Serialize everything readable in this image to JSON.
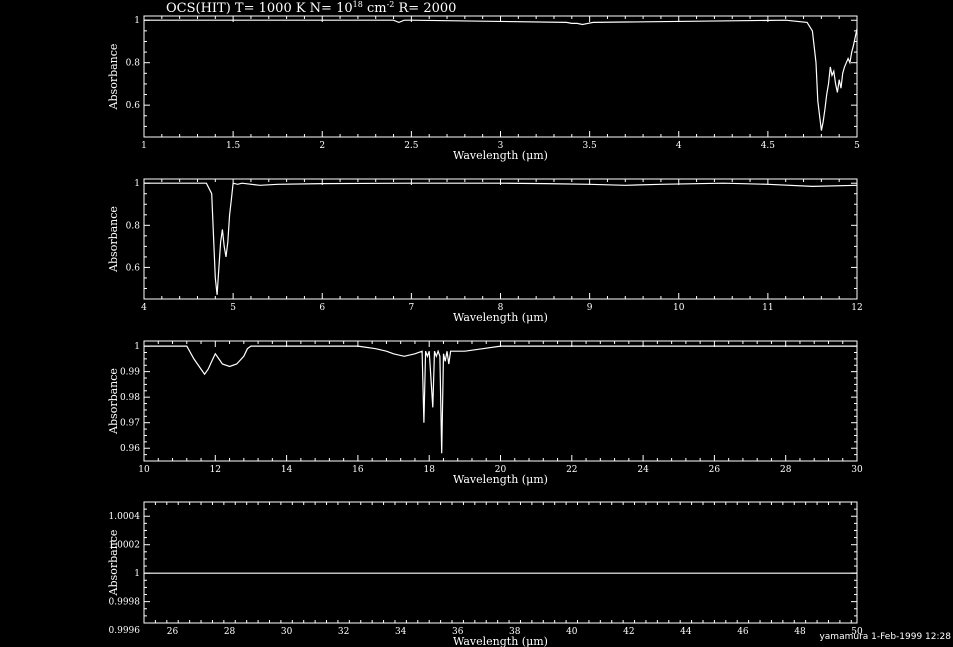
{
  "title": {
    "prefix": "OCS(HIT) T= 1000 K N= 10",
    "n_exp": "18",
    "mid": " cm",
    "cm_exp": "-2",
    "suffix": " R= 2000"
  },
  "footer": "yamamura  1-Feb-1999 12:28",
  "colors": {
    "background": "#000000",
    "foreground": "#ffffff"
  },
  "chart_data": [
    {
      "type": "line",
      "xlabel": "Wavelength (μm)",
      "ylabel": "Absorbance",
      "xlim": [
        1,
        5
      ],
      "ylim": [
        0.45,
        1.02
      ],
      "xticks": [
        1,
        1.5,
        2,
        2.5,
        3,
        3.5,
        4,
        4.5,
        5
      ],
      "xtick_labels": [
        "1",
        "1.5",
        "2",
        "2.5",
        "3",
        "3.5",
        "4",
        "4.5",
        "5"
      ],
      "yticks": [
        0.6,
        0.8,
        1
      ],
      "ytick_labels": [
        "0.6",
        "0.8",
        "1"
      ],
      "series": [
        {
          "x": [
            1,
            2.4,
            2.43,
            2.46,
            2.5,
            3.37,
            3.4,
            3.43,
            3.46,
            3.49,
            3.52,
            4.6,
            4.72,
            4.75,
            4.77,
            4.78,
            4.79,
            4.8,
            4.81,
            4.82,
            4.83,
            4.84,
            4.85,
            4.86,
            4.87,
            4.88,
            4.89,
            4.9,
            4.91,
            4.92,
            4.93,
            4.94,
            4.95,
            4.96,
            4.97,
            4.98,
            4.99,
            5
          ],
          "y": [
            1,
            1,
            0.99,
            1,
            1,
            0.99,
            0.985,
            0.985,
            0.98,
            0.985,
            0.99,
            1,
            0.99,
            0.95,
            0.8,
            0.62,
            0.55,
            0.48,
            0.52,
            0.58,
            0.65,
            0.7,
            0.78,
            0.74,
            0.76,
            0.7,
            0.66,
            0.72,
            0.68,
            0.75,
            0.78,
            0.8,
            0.82,
            0.8,
            0.85,
            0.88,
            0.92,
            0.96
          ]
        }
      ]
    },
    {
      "type": "line",
      "xlabel": "Wavelength (μm)",
      "ylabel": "Absorbance",
      "xlim": [
        4,
        12
      ],
      "ylim": [
        0.45,
        1.02
      ],
      "xticks": [
        4,
        5,
        6,
        7,
        8,
        9,
        10,
        11,
        12
      ],
      "xtick_labels": [
        "4",
        "5",
        "6",
        "7",
        "8",
        "9",
        "10",
        "11",
        "12"
      ],
      "yticks": [
        0.6,
        0.8,
        1
      ],
      "ytick_labels": [
        "0.6",
        "0.8",
        "1"
      ],
      "series": [
        {
          "x": [
            4,
            4.7,
            4.76,
            4.78,
            4.8,
            4.82,
            4.84,
            4.86,
            4.88,
            4.9,
            4.92,
            4.94,
            4.96,
            4.98,
            5,
            5.05,
            5.1,
            5.3,
            5.5,
            6,
            7,
            8,
            8.5,
            9,
            9.4,
            9.8,
            10.5,
            11,
            11.5,
            12
          ],
          "y": [
            1,
            1,
            0.95,
            0.75,
            0.55,
            0.47,
            0.6,
            0.72,
            0.78,
            0.7,
            0.65,
            0.72,
            0.85,
            0.92,
            1,
            0.995,
            1,
            0.99,
            0.995,
            0.998,
            1,
            1,
            0.998,
            0.995,
            0.99,
            0.995,
            1,
            0.995,
            0.985,
            0.99
          ]
        }
      ]
    },
    {
      "type": "line",
      "xlabel": "Wavelength (μm)",
      "ylabel": "Absorbance",
      "xlim": [
        10,
        30
      ],
      "ylim": [
        0.955,
        1.002
      ],
      "xticks": [
        10,
        12,
        14,
        16,
        18,
        20,
        22,
        24,
        26,
        28,
        30
      ],
      "xtick_labels": [
        "10",
        "12",
        "14",
        "16",
        "18",
        "20",
        "22",
        "24",
        "26",
        "28",
        "30"
      ],
      "yticks": [
        0.96,
        0.97,
        0.98,
        0.99,
        1
      ],
      "ytick_labels": [
        "0.96",
        "0.97",
        "0.98",
        "0.99",
        "1"
      ],
      "series": [
        {
          "x": [
            10,
            11.2,
            11.4,
            11.6,
            11.7,
            11.8,
            11.9,
            12.0,
            12.1,
            12.2,
            12.4,
            12.6,
            12.8,
            12.9,
            13.0,
            16.0,
            16.5,
            16.8,
            17.0,
            17.3,
            17.6,
            17.8,
            17.85,
            17.9,
            17.95,
            18.0,
            18.1,
            18.15,
            18.2,
            18.25,
            18.3,
            18.35,
            18.4,
            18.45,
            18.5,
            18.55,
            18.6,
            18.8,
            19.0,
            19.5,
            20,
            21,
            30
          ],
          "y": [
            1,
            1,
            0.995,
            0.991,
            0.989,
            0.991,
            0.994,
            0.997,
            0.995,
            0.993,
            0.992,
            0.993,
            0.996,
            0.999,
            1,
            1,
            0.999,
            0.998,
            0.997,
            0.996,
            0.997,
            0.998,
            0.97,
            0.998,
            0.996,
            0.998,
            0.976,
            0.998,
            0.996,
            0.998,
            0.996,
            0.958,
            0.997,
            0.994,
            0.998,
            0.993,
            0.998,
            0.998,
            0.998,
            0.999,
            1,
            1,
            1
          ]
        }
      ]
    },
    {
      "type": "line",
      "xlabel": "Wavelength (μm)",
      "ylabel": "Absorbance",
      "xlim": [
        25,
        50
      ],
      "ylim": [
        0.99965,
        1.0005
      ],
      "xticks": [
        26,
        28,
        30,
        32,
        34,
        36,
        38,
        40,
        42,
        44,
        46,
        48,
        50
      ],
      "xtick_labels": [
        "26",
        "28",
        "30",
        "32",
        "34",
        "36",
        "38",
        "40",
        "42",
        "44",
        "46",
        "48",
        "50"
      ],
      "yticks": [
        0.9996,
        0.9998,
        1,
        1.0002,
        1.0004
      ],
      "ytick_labels": [
        "0.9996",
        "0.9998",
        "1",
        "1.0002",
        "1.0004"
      ],
      "series": [
        {
          "x": [
            25,
            50
          ],
          "y": [
            1,
            1
          ]
        }
      ]
    }
  ]
}
